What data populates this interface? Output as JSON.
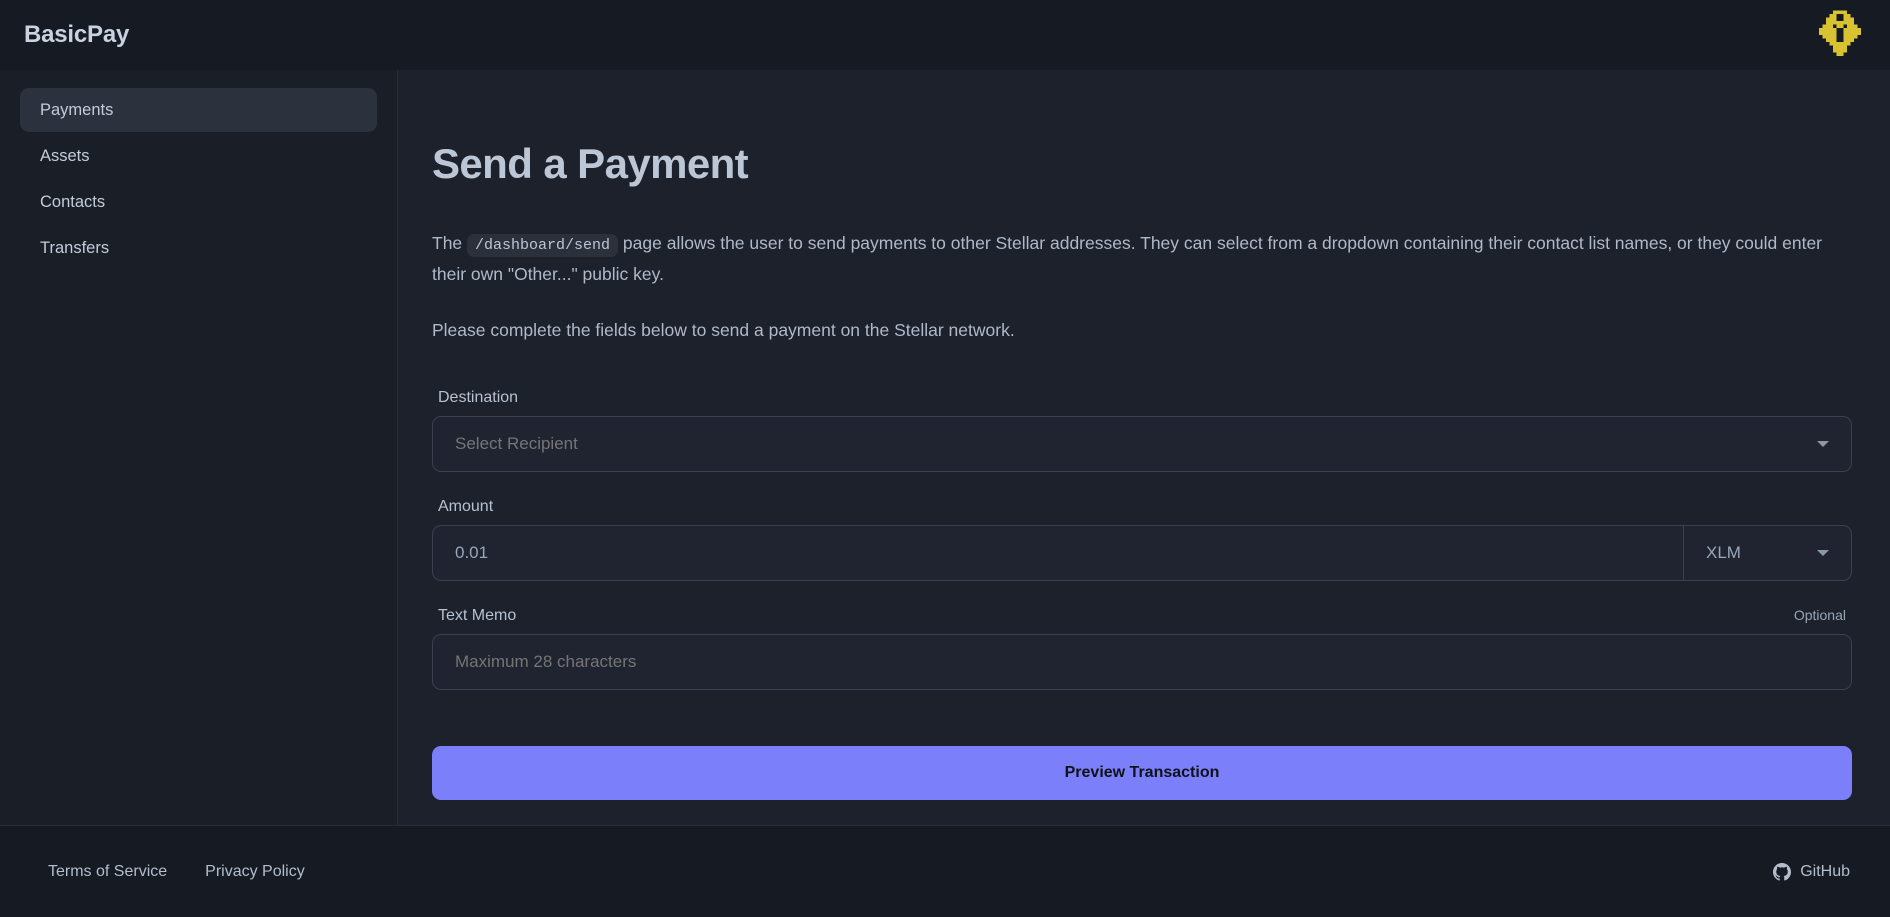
{
  "navbar": {
    "brand": "BasicPay",
    "avatar_icon": "pixel-identicon-avatar",
    "avatar_color": "#d8c231"
  },
  "sidebar": {
    "items": [
      {
        "label": "Payments",
        "active": true
      },
      {
        "label": "Assets",
        "active": false
      },
      {
        "label": "Contacts",
        "active": false
      },
      {
        "label": "Transfers",
        "active": false
      }
    ]
  },
  "main": {
    "page_title": "Send a Payment",
    "intro": {
      "prefix": "The ",
      "code": "/dashboard/send",
      "suffix": " page allows the user to send payments to other Stellar addresses. They can select from a dropdown containing their contact list names, or they could enter their own \"Other...\" public key."
    },
    "instructions": "Please complete the fields below to send a payment on the Stellar network.",
    "form": {
      "destination": {
        "label": "Destination",
        "value": "",
        "placeholder": "Select Recipient",
        "caret_icon": "chevron-down-icon"
      },
      "amount": {
        "label": "Amount",
        "value": "0.01",
        "placeholder": "0.01",
        "asset": "XLM",
        "caret_icon": "chevron-down-icon"
      },
      "memo": {
        "label": "Text Memo",
        "hint": "Optional",
        "value": "",
        "placeholder": "Maximum 28 characters"
      },
      "submit_label": "Preview Transaction",
      "submit_color": "#7b80fa"
    }
  },
  "footer": {
    "terms_label": "Terms of Service",
    "privacy_label": "Privacy Policy",
    "github_label": "GitHub",
    "github_icon": "github-icon"
  }
}
